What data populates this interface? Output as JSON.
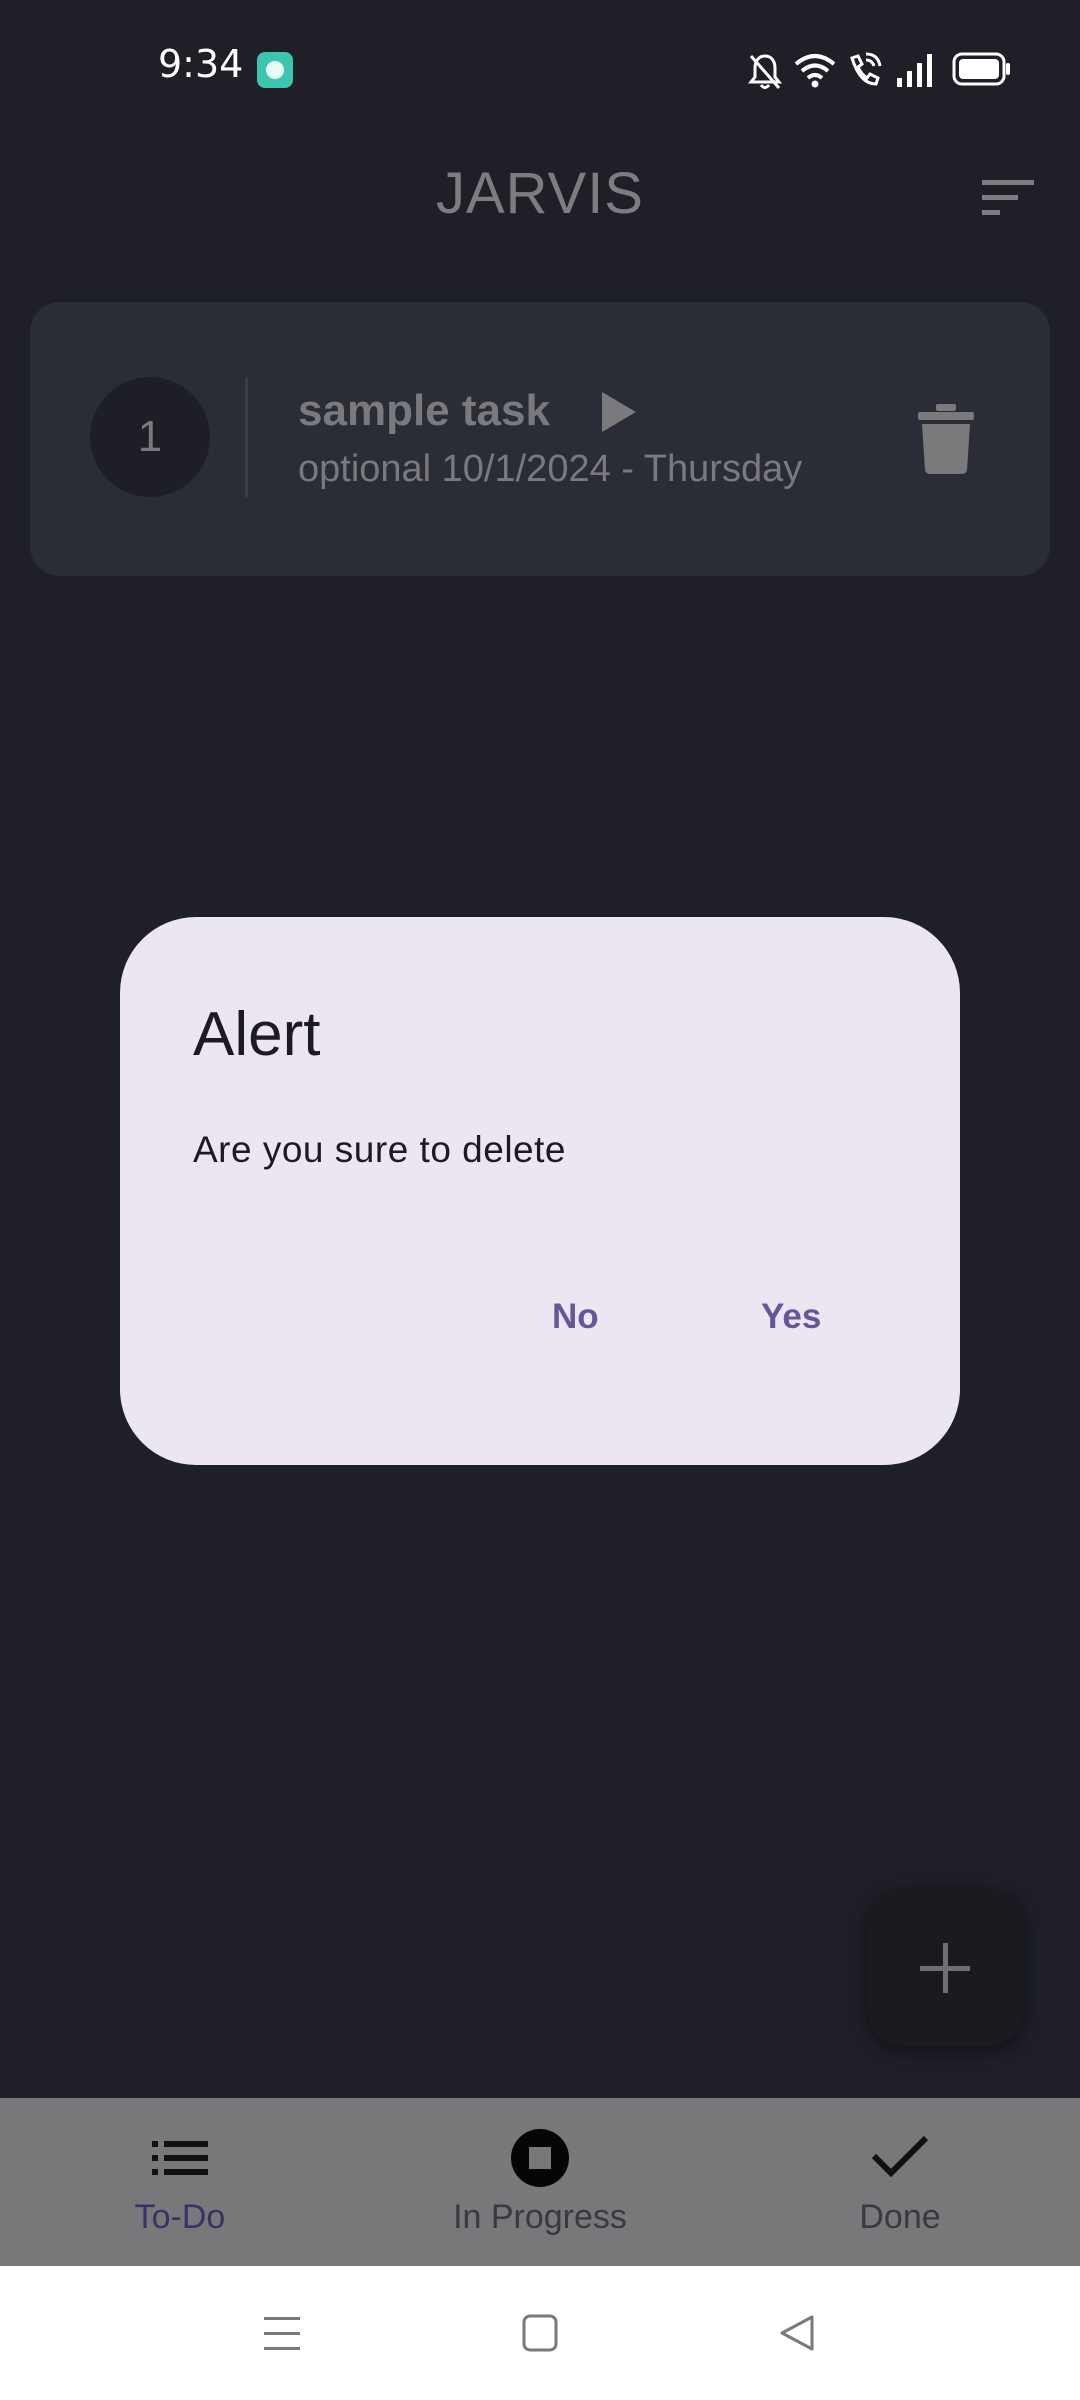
{
  "status_bar": {
    "time": "9:34",
    "icons": [
      "app-notification-icon",
      "mute-icon",
      "wifi-icon",
      "wifi-calling-icon",
      "signal-icon",
      "battery-icon"
    ]
  },
  "app_bar": {
    "title": "JARVIS",
    "action_icon": "sort-icon"
  },
  "tasks": [
    {
      "number": "1",
      "title": "sample task",
      "subtitle": "optional 10/1/2024 - Thursday",
      "action_icon": "play-icon",
      "delete_icon": "trash-icon"
    }
  ],
  "dialog": {
    "title": "Alert",
    "message": "Are you sure to delete",
    "no_label": "No",
    "yes_label": "Yes"
  },
  "fab": {
    "icon": "plus-icon"
  },
  "bottom_nav": {
    "items": [
      {
        "label": "To-Do",
        "icon": "list-icon",
        "active": true
      },
      {
        "label": "In Progress",
        "icon": "stop-circle-icon",
        "active": false
      },
      {
        "label": "Done",
        "icon": "check-icon",
        "active": false
      }
    ]
  },
  "system_nav": {
    "icons": [
      "menu-icon",
      "home-icon",
      "back-icon"
    ]
  },
  "colors": {
    "background": "#1e1f27",
    "card": "#2a2c36",
    "dialog": "#ece6f2",
    "dialog_button": "#65559a",
    "bottom_nav": "#78787b"
  }
}
